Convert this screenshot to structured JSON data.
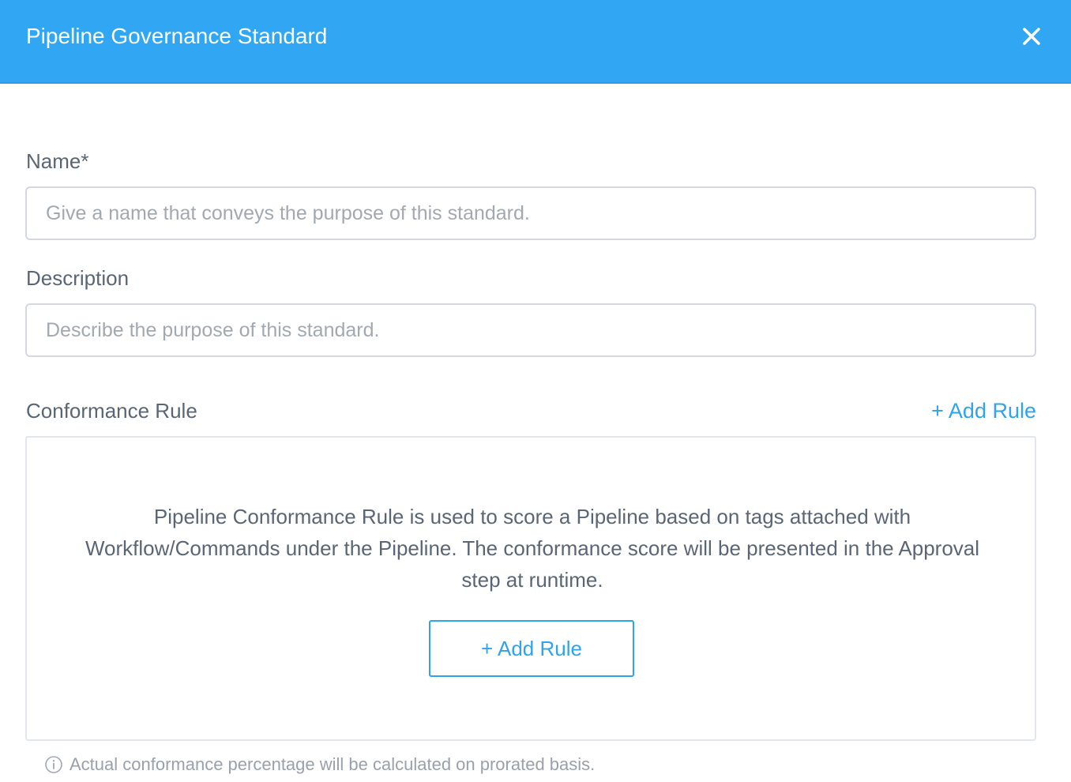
{
  "header": {
    "title": "Pipeline Governance Standard",
    "close_icon": "close-icon",
    "color": "#31a7f4"
  },
  "form": {
    "name": {
      "label": "Name*",
      "placeholder": "Give a name that conveys the purpose of this standard.",
      "value": ""
    },
    "description": {
      "label": "Description",
      "placeholder": "Describe the purpose of this standard.",
      "value": ""
    }
  },
  "conformance": {
    "label": "Conformance Rule",
    "add_rule_link": "+ Add Rule",
    "empty_text": "Pipeline Conformance Rule is used to score a Pipeline based on tags attached with Workflow/Commands under the Pipeline. The conformance score will be presented in the Approval step at runtime.",
    "add_rule_button": "+ Add Rule",
    "accent_color": "#2ea3ee"
  },
  "footnote": {
    "icon": "info-icon",
    "text": "Actual conformance percentage will be calculated on prorated basis."
  }
}
